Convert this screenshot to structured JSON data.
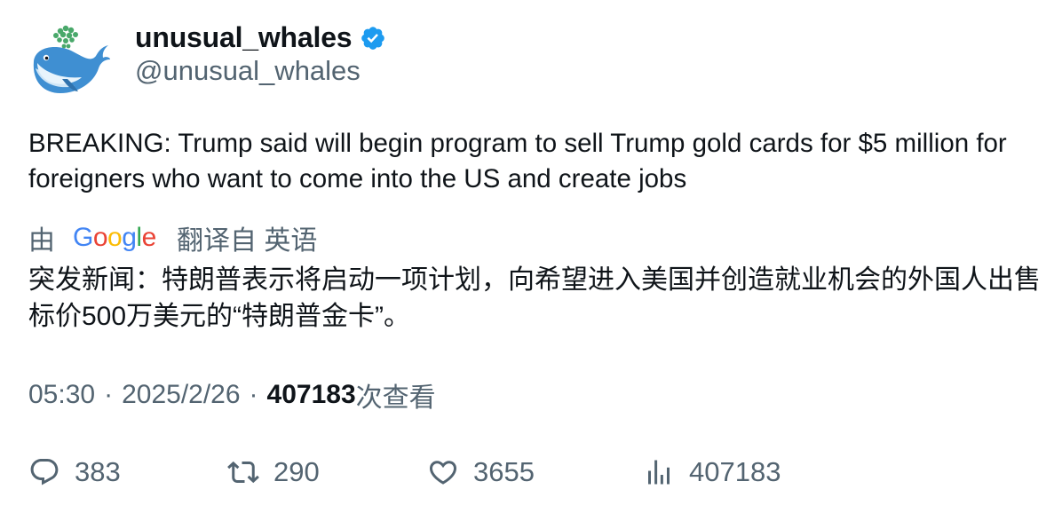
{
  "author": {
    "display_name": "unusual_whales",
    "handle": "@unusual_whales",
    "avatar_icon": "whale-avatar-icon",
    "verified": true,
    "verified_color": "#1d9bf0"
  },
  "tweet": {
    "text": "BREAKING: Trump said will begin program to sell Trump gold cards for $5 million for foreigners who want to come into the US and create jobs"
  },
  "translation": {
    "prefix": "由",
    "provider_logo": "google-logo",
    "suffix": "翻译自 英语",
    "text": "突发新闻：特朗普表示将启动一项计划，向希望进入美国并创造就业机会的外国人出售标价500万美元的“特朗普金卡”。"
  },
  "meta": {
    "time": "05:30",
    "separator": "·",
    "date": "2025/2/26",
    "views_count": "407183",
    "views_label": "次查看"
  },
  "actions": {
    "replies": "383",
    "retweets": "290",
    "likes": "3655",
    "views": "407183"
  }
}
